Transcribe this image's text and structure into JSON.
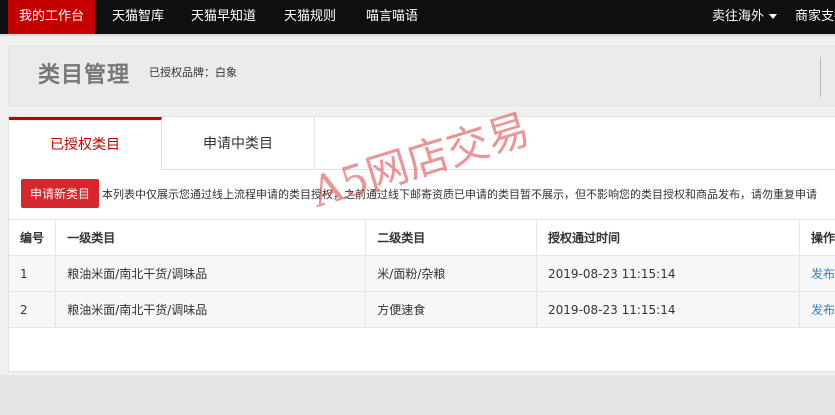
{
  "topnav": {
    "items": [
      "我的工作台",
      "天猫智库",
      "天猫早知道",
      "天猫规则",
      "喵言喵语"
    ],
    "right_items": [
      "卖往海外",
      "商家支持"
    ]
  },
  "header": {
    "title": "类目管理",
    "brand_label": "已授权品牌：白象"
  },
  "tabs": [
    "已授权类目",
    "申请中类目"
  ],
  "actions": {
    "apply_button": "申请新类目",
    "notice": "本列表中仅展示您通过线上流程申请的类目授权，之前通过线下邮寄资质已申请的类目暂不展示，但不影响您的类目授权和商品发布，请勿重复申请"
  },
  "table": {
    "headers": [
      "编号",
      "一级类目",
      "二级类目",
      "授权通过时间",
      "操作"
    ],
    "rows": [
      [
        "1",
        "粮油米面/南北干货/调味品",
        "米/面粉/杂粮",
        "2019-08-23 11:15:14",
        "发布"
      ],
      [
        "2",
        "粮油米面/南北干货/调味品",
        "方便速食",
        "2019-08-23 11:15:14",
        "发布"
      ]
    ]
  },
  "watermark": "A5网店交易",
  "colors": {
    "accent": "#c40000",
    "button": "#d7262c",
    "link": "#2a7fd6",
    "nav_bg": "#0f0f0f"
  }
}
